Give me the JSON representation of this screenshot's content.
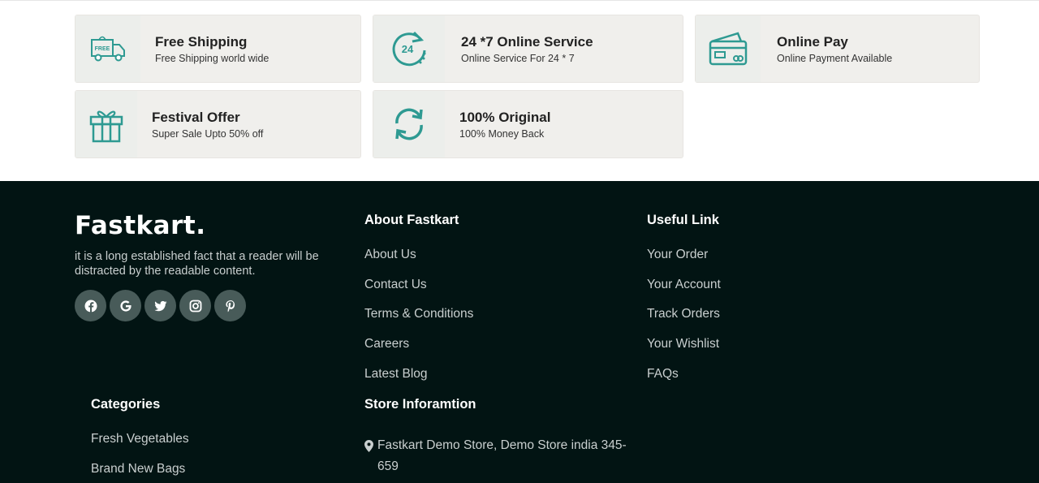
{
  "services": [
    {
      "title": "Free Shipping",
      "subtitle": "Free Shipping world wide",
      "icon": "truck-icon",
      "badge": "FREE"
    },
    {
      "title": "24 *7 Online Service",
      "subtitle": "Online Service For 24 * 7",
      "icon": "clock-24-icon",
      "badge": "24"
    },
    {
      "title": "Online Pay",
      "subtitle": "Online Payment Available",
      "icon": "card-icon"
    },
    {
      "title": "Festival Offer",
      "subtitle": "Super Sale Upto 50% off",
      "icon": "gift-icon"
    },
    {
      "title": "100% Original",
      "subtitle": "100% Money Back",
      "icon": "refresh-icon"
    }
  ],
  "footer": {
    "logo": "Fastkart.",
    "description": "it is a long established fact that a reader will be distracted by the readable content.",
    "socials": [
      "facebook-icon",
      "google-icon",
      "twitter-icon",
      "instagram-icon",
      "pinterest-icon"
    ],
    "about": {
      "heading": "About Fastkart",
      "links": [
        "About Us",
        "Contact Us",
        "Terms & Conditions",
        "Careers",
        "Latest Blog"
      ]
    },
    "useful": {
      "heading": "Useful Link",
      "links": [
        "Your Order",
        "Your Account",
        "Track Orders",
        "Your Wishlist",
        "FAQs"
      ]
    },
    "categories": {
      "heading": "Categories",
      "links": [
        "Fresh Vegetables",
        "Brand New Bags"
      ]
    },
    "store": {
      "heading": "Store Inforamtion",
      "address": "Fastkart Demo Store, Demo Store india 345-659"
    }
  },
  "colors": {
    "accent": "#2e9a92",
    "footer_bg": "#021413",
    "card_bg": "#f0efec"
  }
}
